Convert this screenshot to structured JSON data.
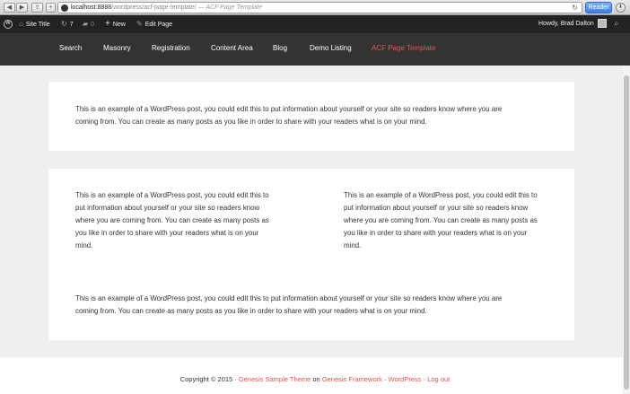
{
  "browser": {
    "back": "◀",
    "forward": "▶",
    "share": "⇪",
    "add": "+",
    "url_host": "localhost:8888",
    "url_path": "/wordpress/acf-page-template/",
    "url_title": "— ACF Page Template",
    "reload": "↻",
    "reader": "Reader",
    "download": "⬇"
  },
  "adminbar": {
    "wp_logo": "W",
    "site_icon": "⌂",
    "site_title": "Site Title",
    "updates_icon": "↻",
    "updates_count": "7",
    "comments_icon": "▰",
    "comments_count": "0",
    "new_icon": "+",
    "new_label": "New",
    "edit_icon": "✎",
    "edit_label": "Edit Page",
    "howdy": "Howdy, Brad Dalton",
    "search_icon": "⌕"
  },
  "nav": {
    "items": [
      "Search",
      "Masonry",
      "Registration",
      "Content Area",
      "Blog",
      "Demo Listing",
      "ACF Page Template"
    ]
  },
  "content": {
    "top_line1": "This is an example of a WordPress post, you could edit this to put information about yourself or your site so readers know where you are",
    "top_line2": "coming from. You can create as many posts as you like in order to share with your readers what is on your mind.",
    "col_line1": "This is an example of a WordPress post, you could edit this to",
    "col_line2": "put information about yourself or your site so readers know",
    "col_line3": "where you are coming from. You can create as many posts as",
    "col_line4": "you like in order to share with your readers what is on your",
    "col_line5": "mind.",
    "bottom_line1": "This is an example of a WordPress post, you could edit this to put information about yourself or your site so readers know where you are",
    "bottom_line2": "coming from. You can create as many posts as you like in order to share with your readers what is on your mind."
  },
  "footer": {
    "copyright": "Copyright © 2015 ·",
    "theme_link": "Genesis Sample Theme",
    "on": "on",
    "framework_link": "Genesis Framework",
    "sep1": "·",
    "wp_link": "WordPress",
    "sep2": "·",
    "logout_link": "Log out"
  },
  "colors": {
    "accent": "#e5554e",
    "admin_bar": "#222222",
    "nav_bar": "#333333"
  }
}
